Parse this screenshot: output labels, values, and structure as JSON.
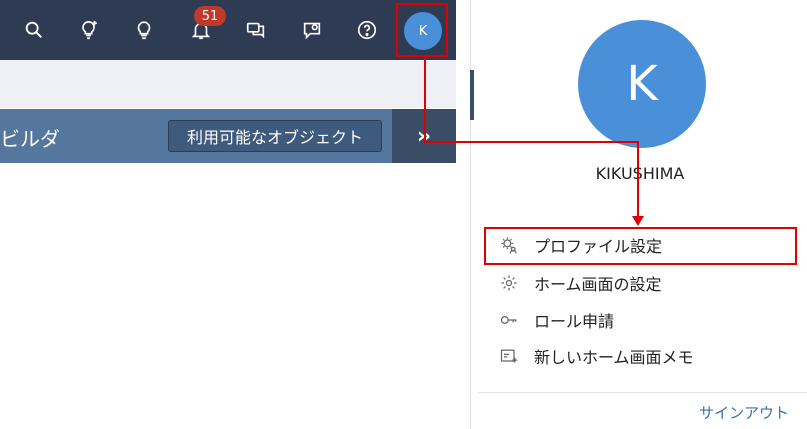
{
  "topbar": {
    "icons": [
      "search-icon",
      "idea-add-icon",
      "lightbulb-icon",
      "bell-icon",
      "chat-icon",
      "feedback-icon",
      "help-icon"
    ],
    "notification_count": "51",
    "avatar_initial": "K"
  },
  "builder": {
    "title": "ビルダ",
    "objects_button": "利用可能なオブジェクト",
    "expand_label": "»"
  },
  "profile_panel": {
    "avatar_initial": "K",
    "username": "KIKUSHIMA",
    "menu": [
      {
        "label": "プロファイル設定",
        "icon": "profile-settings-icon"
      },
      {
        "label": "ホーム画面の設定",
        "icon": "gear-icon"
      },
      {
        "label": "ロール申請",
        "icon": "key-icon"
      },
      {
        "label": "新しいホーム画面メモ",
        "icon": "note-add-icon"
      }
    ],
    "signout": "サインアウト"
  },
  "colors": {
    "topbar": "#2f3b52",
    "builder_bar": "#56779d",
    "avatar": "#4a90d9",
    "highlight": "#e00000",
    "badge": "#c0392b"
  }
}
